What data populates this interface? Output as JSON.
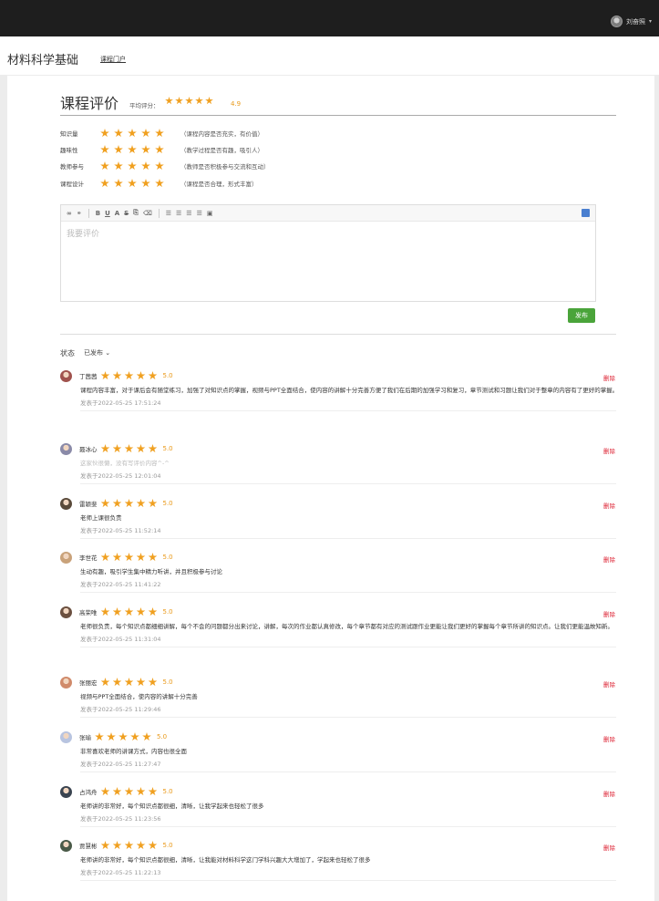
{
  "topbar": {
    "username": "刘奋照"
  },
  "header": {
    "course_title": "材料科学基础",
    "portal_link": "课程门户"
  },
  "evaluation": {
    "title": "课程评价",
    "avg_label": "平均评分：",
    "avg_stars": 5,
    "avg_score": "4.9",
    "criteria": [
      {
        "label": "知识量",
        "stars": 5,
        "hint": "（课程内容是否充实，有价值）"
      },
      {
        "label": "趣味性",
        "stars": 5,
        "hint": "（教学过程是否有趣，吸引人）"
      },
      {
        "label": "教师参与",
        "stars": 5,
        "hint": "（教师是否积极参与交流和互动）"
      },
      {
        "label": "课程设计",
        "stars": 5,
        "hint": "（课程是否合理，形式丰富）"
      }
    ]
  },
  "editor": {
    "placeholder": "我要评价",
    "publish_label": "发布"
  },
  "filter": {
    "status_label": "状态",
    "status_value": "已发布"
  },
  "delete_label": "删除",
  "reviews": [
    {
      "name": "丁茜茜",
      "stars": 5,
      "score": "5.0",
      "content": "课程内容丰富，对于课后会有随堂练习，加强了对知识点的掌握，视频与PPT全面结合，使内容的讲解十分完善方便了我们在后期的加强学习和复习，章节测试和习题让我们对于整章的内容有了更好的掌握。",
      "time": "发表于2022-05-25 17:51:24",
      "avatar_color": "#a0524d"
    },
    {
      "name": "聂冰心",
      "stars": 5,
      "score": "5.0",
      "content": "这家伙很懒，没有写评价内容^-^",
      "time": "发表于2022-05-25 12:01:04",
      "avatar_color": "#8a8aa8",
      "empty": true
    },
    {
      "name": "雷颖斐",
      "stars": 5,
      "score": "5.0",
      "content": "老师上课很负责",
      "time": "发表于2022-05-25 11:52:14",
      "avatar_color": "#5a4a3a"
    },
    {
      "name": "李世花",
      "stars": 5,
      "score": "5.0",
      "content": "生动有趣，吸引学生集中精力听讲，并且积极参与讨论",
      "time": "发表于2022-05-25 11:41:22",
      "avatar_color": "#c9a27a"
    },
    {
      "name": "高荣唯",
      "stars": 5,
      "score": "5.0",
      "content": "老师很负责，每个知识点都细细讲解，每个不会的问题都分出来讨论，讲解，每次的作业都认真修改，每个章节都有对应的测试跟作业更能让我们更好的掌握每个章节所讲的知识点。让我们更能温故知新。",
      "time": "发表于2022-05-25 11:31:04",
      "avatar_color": "#6b5040"
    },
    {
      "name": "张丽宏",
      "stars": 5,
      "score": "5.0",
      "content": "视频与PPT全面结合，使内容的讲解十分完善",
      "time": "发表于2022-05-25 11:29:46",
      "avatar_color": "#d08a6a"
    },
    {
      "name": "张瑜",
      "stars": 5,
      "score": "5.0",
      "content": "非常喜欢老师的讲课方式，内容也很全面",
      "time": "发表于2022-05-25 11:27:47",
      "avatar_color": "#b8c4e0"
    },
    {
      "name": "占鸿舟",
      "stars": 5,
      "score": "5.0",
      "content": "老师讲的非常好，每个知识点都很细，清晰，让我学起来也轻松了很多",
      "time": "发表于2022-05-25 11:23:56",
      "avatar_color": "#3a4450"
    },
    {
      "name": "贾慧彬",
      "stars": 5,
      "score": "5.0",
      "content": "老师讲的非常好，每个知识点都很细，清晰，让我能对材料科学这门学科兴趣大大增加了，学起来也轻松了很多",
      "time": "发表于2022-05-25 11:22:13",
      "avatar_color": "#4a5a48"
    }
  ]
}
